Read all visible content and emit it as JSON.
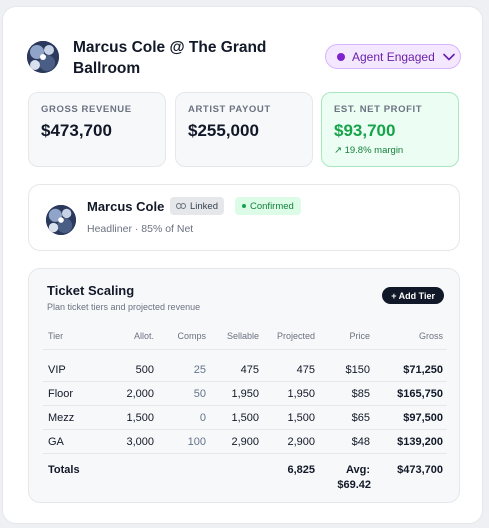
{
  "header": {
    "title": "Marcus Cole @ The Grand Ballroom",
    "status_label": "Agent Engaged"
  },
  "stats": [
    {
      "label": "GROSS REVENUE",
      "value": "$473,700"
    },
    {
      "label": "ARTIST PAYOUT",
      "value": "$255,000"
    },
    {
      "label": "EST. NET PROFIT",
      "value": "$93,700",
      "sub": "↗ 19.8% margin"
    }
  ],
  "artist": {
    "name": "Marcus Cole",
    "linked_label": "Linked",
    "confirmed_label": "Confirmed",
    "subtitle": "Headliner · 85% of Net"
  },
  "scaling": {
    "title": "Ticket Scaling",
    "subtitle": "Plan ticket tiers and projected revenue",
    "add_label": "+ Add Tier",
    "columns": [
      "Tier",
      "Allot.",
      "Comps",
      "Sellable",
      "Projected",
      "Price",
      "Gross"
    ],
    "rows": [
      [
        "VIP",
        "500",
        "25",
        "475",
        "475",
        "$150",
        "$71,250"
      ],
      [
        "Floor",
        "2,000",
        "50",
        "1,950",
        "1,950",
        "$85",
        "$165,750"
      ],
      [
        "Mezz",
        "1,500",
        "0",
        "1,500",
        "1,500",
        "$65",
        "$97,500"
      ],
      [
        "GA",
        "3,000",
        "100",
        "2,900",
        "2,900",
        "$48",
        "$139,200"
      ]
    ],
    "totals": {
      "label": "Totals",
      "projected": "6,825",
      "avg_label": "Avg:",
      "avg_price": "$69.42",
      "gross": "$473,700"
    }
  }
}
